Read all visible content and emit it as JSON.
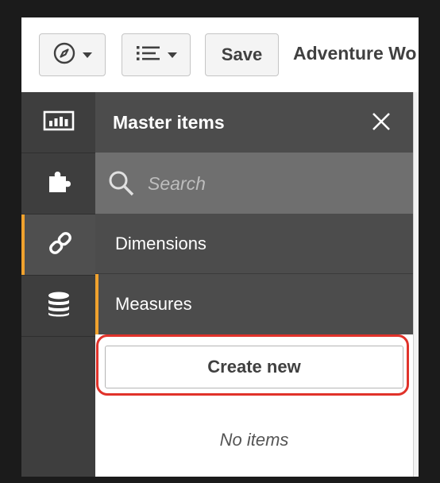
{
  "toolbar": {
    "nav_icon": "compass-icon",
    "list_icon": "list-icon",
    "save_label": "Save",
    "app_title": "Adventure Wo"
  },
  "rail": {
    "items": [
      {
        "icon": "chart-icon",
        "active": false
      },
      {
        "icon": "puzzle-icon",
        "active": false
      },
      {
        "icon": "link-icon",
        "active": true
      },
      {
        "icon": "database-icon",
        "active": false
      }
    ]
  },
  "panel": {
    "title": "Master items",
    "close_icon": "close-icon",
    "search_placeholder": "Search",
    "categories": [
      {
        "label": "Dimensions"
      },
      {
        "label": "Measures",
        "selected": true
      }
    ],
    "create_label": "Create new",
    "empty_text": "No items"
  },
  "colors": {
    "accent": "#f0a22e",
    "highlight": "#e0322a",
    "panel_dark": "#4c4c4c",
    "rail": "#3e3e3e"
  }
}
